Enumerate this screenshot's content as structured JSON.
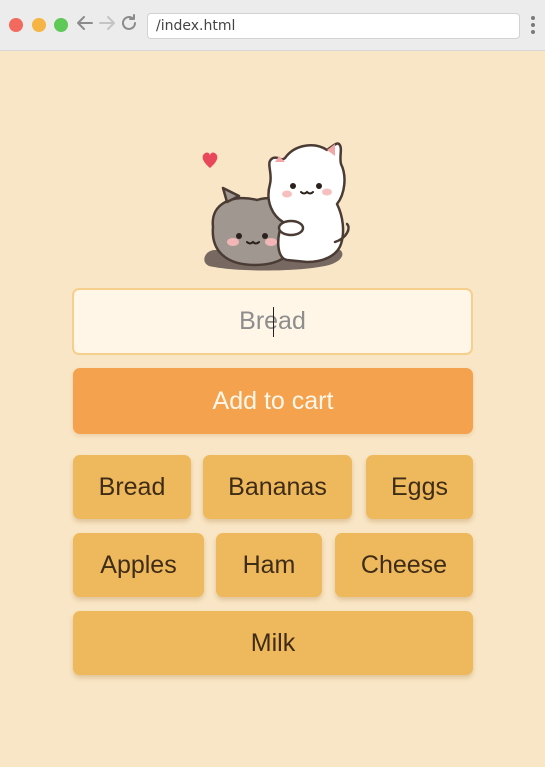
{
  "browser": {
    "url": "/index.html"
  },
  "form": {
    "input_placeholder": "Bread",
    "add_button_label": "Add to cart"
  },
  "items": [
    "Bread",
    "Bananas",
    "Eggs",
    "Apples",
    "Ham",
    "Cheese",
    "Milk"
  ],
  "colors": {
    "background": "#f9e6c6",
    "accent": "#f4a24e",
    "chip": "#eeb85c",
    "heart": "#e8485a"
  },
  "icons": {
    "mascot": "two-cats-hug-icon",
    "heart": "heart-icon"
  }
}
